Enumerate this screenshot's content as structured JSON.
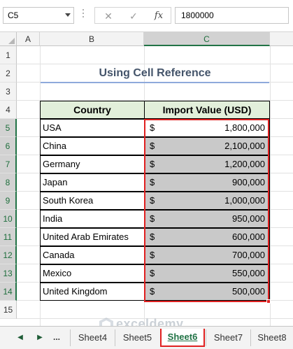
{
  "formula_bar": {
    "name_box": "C5",
    "cancel_symbol": "✕",
    "enter_symbol": "✓",
    "fx_symbol": "fx",
    "formula_value": "1800000"
  },
  "columns": [
    "A",
    "B",
    "C"
  ],
  "selected_column": "C",
  "rows": [
    "1",
    "2",
    "3",
    "4",
    "5",
    "6",
    "7",
    "8",
    "9",
    "10",
    "11",
    "12",
    "13",
    "14",
    "15"
  ],
  "title": "Using Cell Reference",
  "table": {
    "header_country": "Country",
    "header_value": "Import Value (USD)",
    "currency_symbol": "$",
    "rows": [
      {
        "country": "USA",
        "value": "1,800,000"
      },
      {
        "country": "China",
        "value": "2,100,000"
      },
      {
        "country": "Germany",
        "value": "1,200,000"
      },
      {
        "country": "Japan",
        "value": "900,000"
      },
      {
        "country": "South Korea",
        "value": "1,000,000"
      },
      {
        "country": "India",
        "value": "950,000"
      },
      {
        "country": "United Arab Emirates",
        "value": "600,000"
      },
      {
        "country": "Canada",
        "value": "700,000"
      },
      {
        "country": "Mexico",
        "value": "550,000"
      },
      {
        "country": "United Kingdom",
        "value": "500,000"
      }
    ]
  },
  "sheet_tabs": {
    "nav_prev": "◀",
    "nav_next": "▶",
    "more": "...",
    "tabs": [
      "Sheet4",
      "Sheet5",
      "Sheet6",
      "Sheet7",
      "Sheet8"
    ],
    "active": "Sheet6"
  },
  "watermark": {
    "name": "exceldemy",
    "sub": "EXCEL · DATA · BI"
  },
  "colors": {
    "accent_green": "#217346",
    "highlight_red": "#e02020",
    "header_fill": "#e2efda",
    "value_fill": "#c9c9c9",
    "title_color": "#44546a"
  }
}
